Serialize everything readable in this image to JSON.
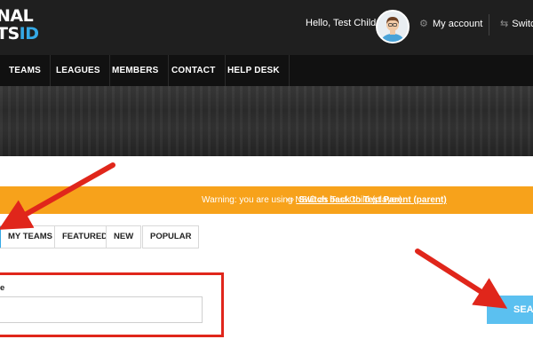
{
  "header": {
    "logo_line1": "NAL",
    "logo_line2_main": "TS",
    "logo_line2_accent": "ID",
    "greeting": "Hello, Test Child",
    "my_account": "My account",
    "switch_label": "Switc"
  },
  "icons": {
    "gear": "gear-icon",
    "switch": "switch-user-icon",
    "avatar": "user-avatar",
    "link": "switch-link-icon"
  },
  "nav": {
    "items": [
      "TEAMS",
      "LEAGUES",
      "MEMBERS",
      "CONTACT",
      "HELP DESK"
    ]
  },
  "warning": {
    "text": "Warning: you are using NSID as Test Child (player).",
    "link": "Switch back to Test Parent (parent)"
  },
  "tabs": [
    "MY TEAMS",
    "FEATURED",
    "NEW",
    "POPULAR"
  ],
  "form": {
    "label": "e",
    "input_value": "",
    "search_button": "SEAR"
  },
  "colors": {
    "header_bg": "#1f1f1f",
    "nav_bg": "#111111",
    "accent": "#35a9e6",
    "warning": "#f7a21b",
    "search_button": "#5bc0f0",
    "annotation": "#e0261b"
  }
}
